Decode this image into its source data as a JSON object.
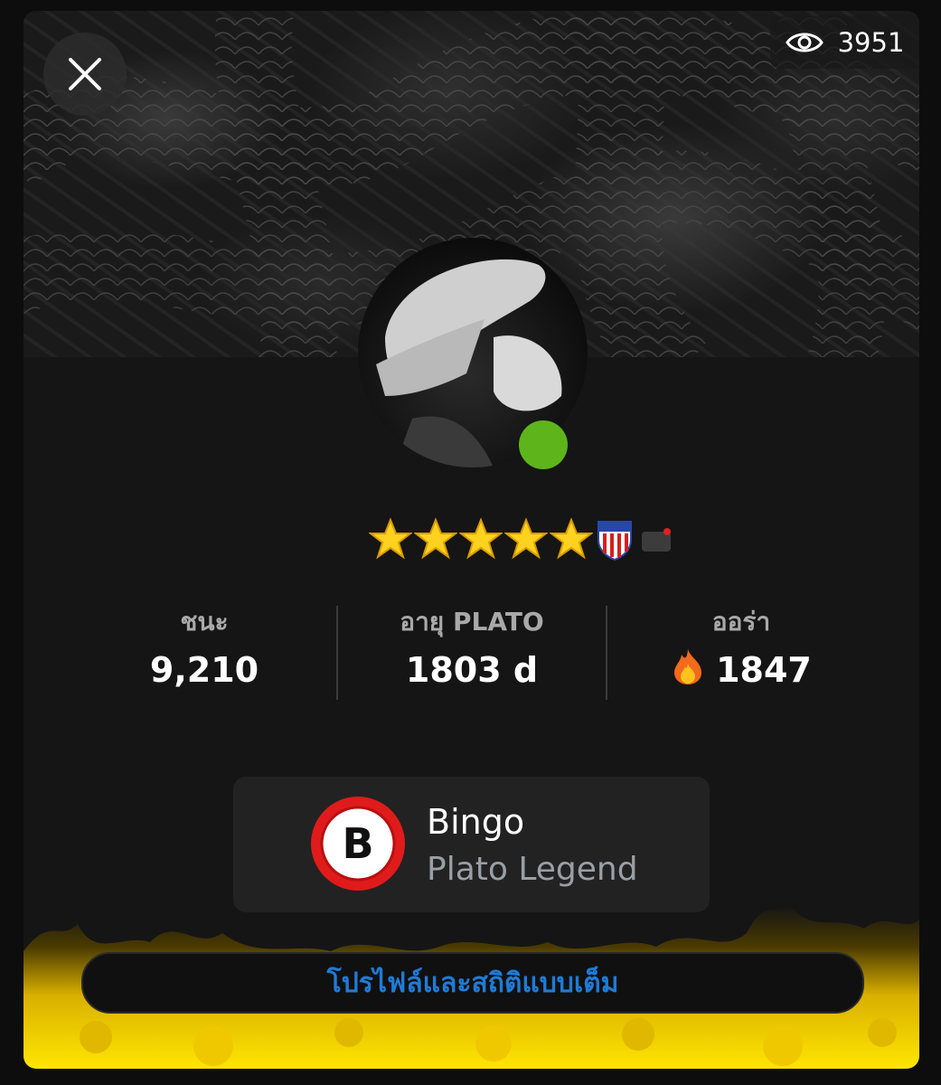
{
  "header": {
    "close_icon": "close-icon",
    "views_icon": "eye-icon",
    "views_count": "3951"
  },
  "profile": {
    "online": true,
    "status_color": "#5db51b",
    "badges": [
      "star-icon",
      "star-icon",
      "star-icon",
      "star-icon",
      "star-icon",
      "shield-badge-icon",
      "notification-badge-icon"
    ]
  },
  "stats": [
    {
      "label": "ชนะ",
      "value": "9,210"
    },
    {
      "label": "อายุ PLATO",
      "value": "1803 d"
    },
    {
      "label": "ออร่า",
      "value": "1847",
      "icon": "fire-icon"
    }
  ],
  "game": {
    "logo_letter": "B",
    "name": "Bingo",
    "title": "Plato Legend"
  },
  "actions": {
    "full_profile_label": "โปรไฟล์และสถิติแบบเต็ม"
  },
  "colors": {
    "accent_blue": "#1f7bd6",
    "flame_yellow": "#ffd400",
    "logo_red": "#e01b1b"
  }
}
